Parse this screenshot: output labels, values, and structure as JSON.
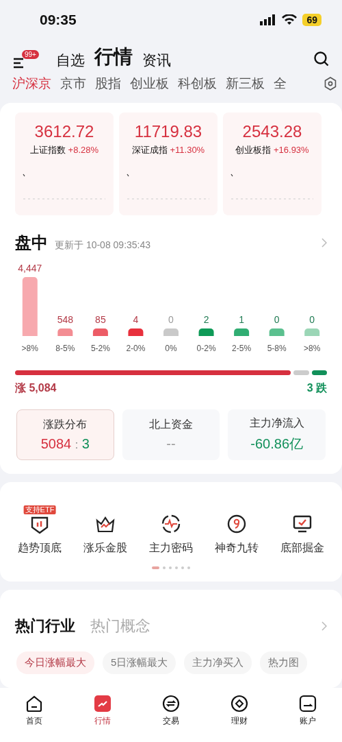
{
  "status_bar": {
    "time": "09:35",
    "battery": "69"
  },
  "header": {
    "badge": "99+",
    "tabs": [
      {
        "label": "自选",
        "selected": false
      },
      {
        "label": "行情",
        "selected": true
      },
      {
        "label": "资讯",
        "selected": false
      }
    ]
  },
  "categories": [
    {
      "label": "沪深京",
      "selected": true
    },
    {
      "label": "京市",
      "selected": false
    },
    {
      "label": "股指",
      "selected": false
    },
    {
      "label": "创业板",
      "selected": false
    },
    {
      "label": "科创板",
      "selected": false
    },
    {
      "label": "新三板",
      "selected": false
    },
    {
      "label": "全",
      "selected": false
    }
  ],
  "indices": [
    {
      "value": "3612.72",
      "name": "上证指数",
      "change": "+8.28%"
    },
    {
      "value": "11719.83",
      "name": "深证成指",
      "change": "+11.30%"
    },
    {
      "value": "2543.28",
      "name": "创业板指",
      "change": "+16.93%"
    }
  ],
  "intraday": {
    "title": "盘中",
    "updated": "更新于 10-08 09:35:43",
    "bins": [
      {
        "label": ">8%",
        "count": "4,447",
        "kind": "tall"
      },
      {
        "label": "8-5%",
        "count": "548",
        "kind": "short"
      },
      {
        "label": "5-2%",
        "count": "85",
        "kind": "short"
      },
      {
        "label": "2-0%",
        "count": "4",
        "kind": "short"
      },
      {
        "label": "0%",
        "count": "0",
        "kind": "short"
      },
      {
        "label": "0-2%",
        "count": "2",
        "kind": "short"
      },
      {
        "label": "2-5%",
        "count": "1",
        "kind": "short"
      },
      {
        "label": "5-8%",
        "count": "0",
        "kind": "short"
      },
      {
        "label": ">8%",
        "count": "0",
        "kind": "short"
      }
    ],
    "breadth": {
      "up_text": "涨 5,084",
      "down_text": "3 跌"
    }
  },
  "stats": [
    {
      "kind": "ratio",
      "label": "涨跌分布",
      "selected": true,
      "up": "5084",
      "sep": ":",
      "down": "3"
    },
    {
      "kind": "value",
      "label": "北上资金",
      "selected": false,
      "value": "--",
      "color": "#999999"
    },
    {
      "kind": "value",
      "label": "主力净流入",
      "selected": false,
      "value": "-60.86亿",
      "color": "#12905a"
    }
  ],
  "tools": [
    {
      "label": "趋势顶底",
      "kind": "shield",
      "badge": "支持ETF"
    },
    {
      "label": "涨乐金股",
      "kind": "crown"
    },
    {
      "label": "主力密码",
      "kind": "pulse"
    },
    {
      "label": "神奇九转",
      "kind": "nine"
    },
    {
      "label": "底部掘金",
      "kind": "monitor"
    }
  ],
  "pager": [
    {
      "selected": true
    },
    {
      "selected": false
    },
    {
      "selected": false
    },
    {
      "selected": false
    },
    {
      "selected": false
    },
    {
      "selected": false
    }
  ],
  "hot": {
    "tabs": [
      {
        "label": "热门行业",
        "selected": true
      },
      {
        "label": "热门概念",
        "selected": false
      }
    ],
    "chips": [
      {
        "label": "今日涨幅最大",
        "selected": true
      },
      {
        "label": "5日涨幅最大",
        "selected": false
      },
      {
        "label": "主力净买入",
        "selected": false
      },
      {
        "label": "热力图",
        "selected": false
      }
    ]
  },
  "nav": [
    {
      "label": "首页",
      "kind": "home",
      "selected": false
    },
    {
      "label": "行情",
      "kind": "market",
      "selected": true
    },
    {
      "label": "交易",
      "kind": "trade",
      "selected": false
    },
    {
      "label": "理财",
      "kind": "wealth",
      "selected": false
    },
    {
      "label": "账户",
      "kind": "account",
      "selected": false
    }
  ]
}
